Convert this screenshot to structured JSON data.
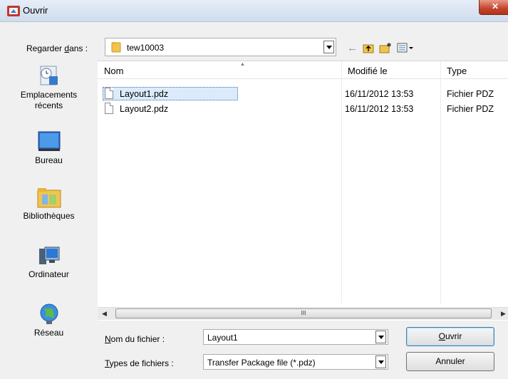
{
  "window": {
    "title": "Ouvrir",
    "close_glyph": "✕"
  },
  "lookin": {
    "label": "Regarder dans :",
    "label_access_key": "d",
    "value": "tew10003"
  },
  "toolbar": {
    "back": "←",
    "up": "up-folder",
    "new_folder": "new-folder",
    "views": "views-menu"
  },
  "places": [
    {
      "label": "Emplacements récents",
      "icon": "recent-places-icon"
    },
    {
      "label": "Bureau",
      "icon": "desktop-icon"
    },
    {
      "label": "Bibliothèques",
      "icon": "libraries-icon"
    },
    {
      "label": "Ordinateur",
      "icon": "computer-icon"
    },
    {
      "label": "Réseau",
      "icon": "network-icon"
    }
  ],
  "list": {
    "columns": [
      "Nom",
      "Modifié le",
      "Type"
    ],
    "rows": [
      {
        "name": "Layout1.pdz",
        "modified": "16/11/2012 13:53",
        "type": "Fichier PDZ",
        "selected": true
      },
      {
        "name": "Layout2.pdz",
        "modified": "16/11/2012 13:53",
        "type": "Fichier PDZ",
        "selected": false
      }
    ]
  },
  "scrollbar": {
    "thumb_grip": "III"
  },
  "filename": {
    "label": "Nom du fichier :",
    "value": "Layout1"
  },
  "filetype": {
    "label": "Types de fichiers :",
    "value": "Transfer Package file (*.pdz)"
  },
  "buttons": {
    "open": "Ouvrir",
    "cancel": "Annuler"
  },
  "colors": {
    "selection": "#dcebfc",
    "close_button": "#c3432d",
    "folder": "#f2c44e"
  }
}
